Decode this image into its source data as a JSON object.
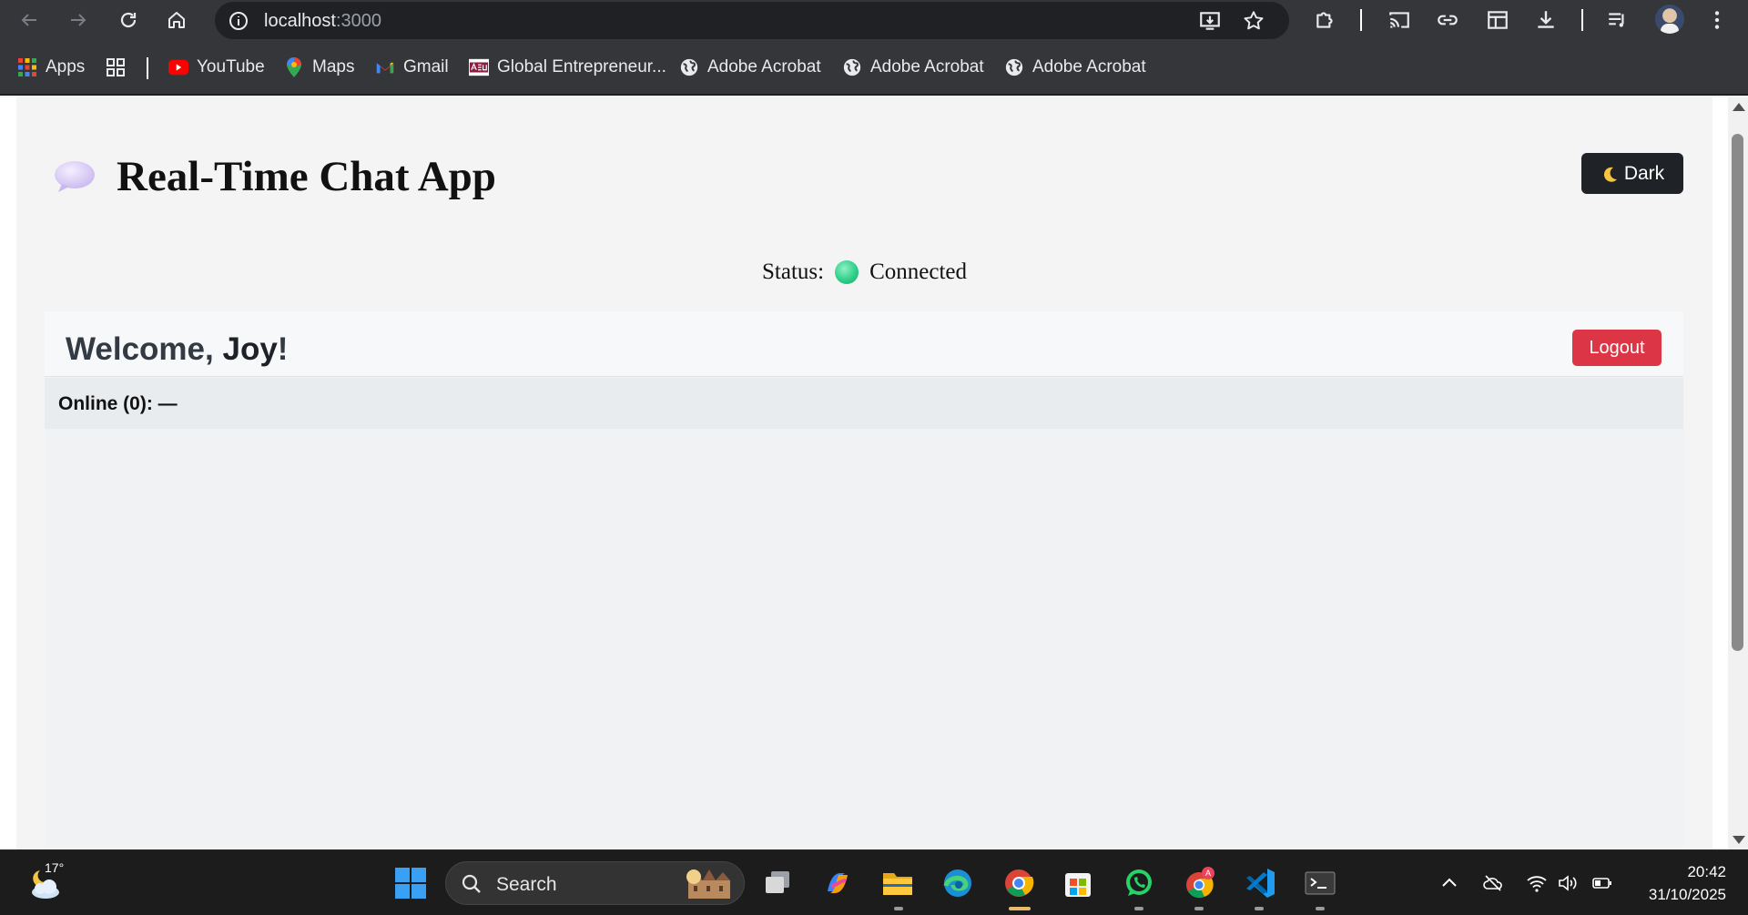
{
  "browser": {
    "url_host": "localhost",
    "url_port": ":3000",
    "bookmarks": {
      "apps": "Apps",
      "youtube": "YouTube",
      "maps": "Maps",
      "gmail": "Gmail",
      "global": "Global Entrepreneur...",
      "acrobat1": "Adobe Acrobat",
      "acrobat2": "Adobe Acrobat",
      "acrobat3": "Adobe Acrobat"
    }
  },
  "app": {
    "title": "Real-Time Chat App",
    "theme_button": "Dark",
    "status_label": "Status:",
    "status_value": "Connected",
    "welcome_prefix": "Welcome, ",
    "user_name": "Joy",
    "welcome_suffix": "!",
    "logout_label": "Logout",
    "online_label": "Online (0): —"
  },
  "taskbar": {
    "temperature": "17°",
    "search_label": "Search",
    "time": "20:42",
    "date": "31/10/2025"
  }
}
